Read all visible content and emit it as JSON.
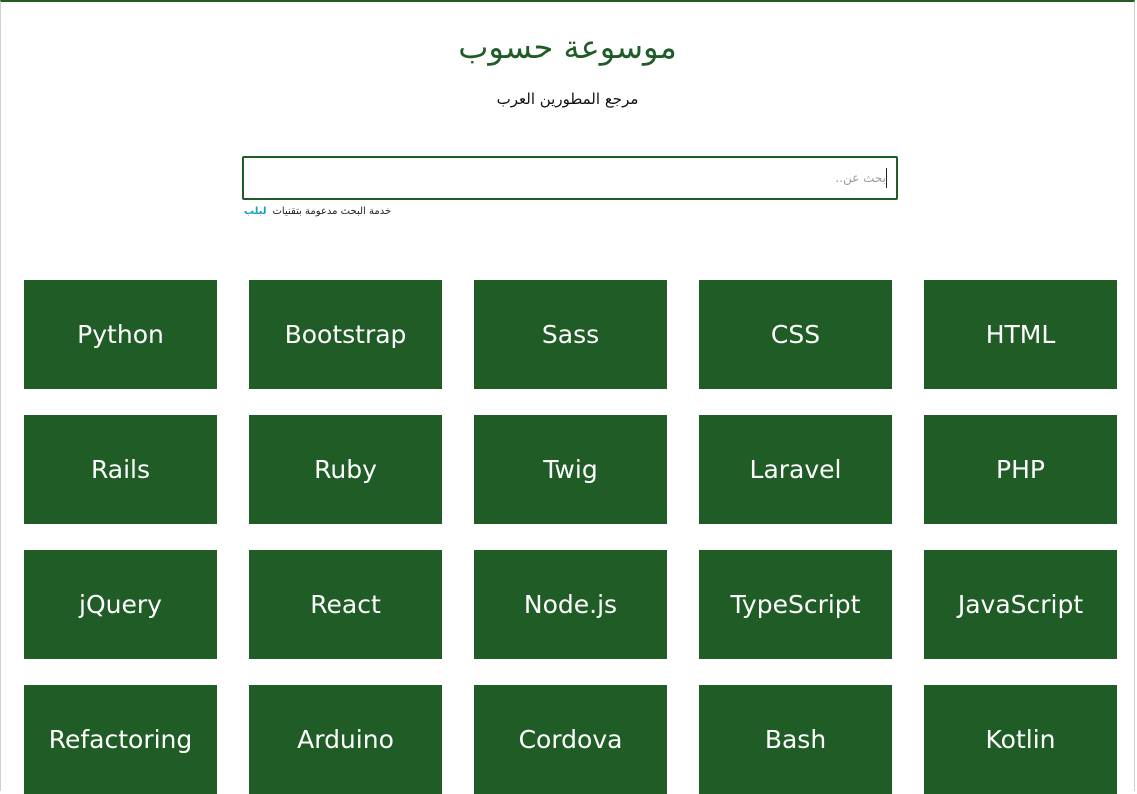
{
  "header": {
    "title": "موسوعة حسوب",
    "subtitle": "مرجع المطورين العرب"
  },
  "search": {
    "placeholder": "بحث عن..",
    "powered_by_text": "خدمة البحث مدعومة بتقنيات",
    "powered_by_brand": "لبلب"
  },
  "colors": {
    "primary": "#1f5c26",
    "tile_text": "#ffffff",
    "brand_logo": "#1aa0c8"
  },
  "topics": [
    {
      "label": "HTML"
    },
    {
      "label": "CSS"
    },
    {
      "label": "Sass"
    },
    {
      "label": "Bootstrap"
    },
    {
      "label": "Python"
    },
    {
      "label": "PHP"
    },
    {
      "label": "Laravel"
    },
    {
      "label": "Twig"
    },
    {
      "label": "Ruby"
    },
    {
      "label": "Rails"
    },
    {
      "label": "JavaScript"
    },
    {
      "label": "TypeScript"
    },
    {
      "label": "Node.js"
    },
    {
      "label": "React"
    },
    {
      "label": "jQuery"
    },
    {
      "label": "Kotlin"
    },
    {
      "label": "Bash"
    },
    {
      "label": "Cordova"
    },
    {
      "label": "Arduino"
    },
    {
      "label": "Refactoring"
    }
  ]
}
